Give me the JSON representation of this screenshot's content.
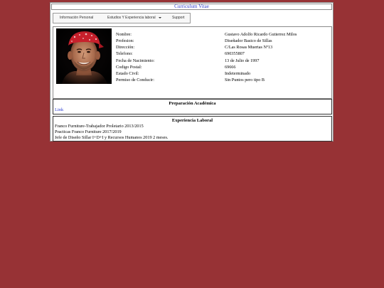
{
  "header": {
    "title": "Curriculum Vitae"
  },
  "nav": {
    "items": [
      {
        "label": "Información Personal"
      },
      {
        "label": "Estudios Y Experiencia laboral"
      },
      {
        "label": "Support"
      }
    ]
  },
  "profile": {
    "photo_icon": "profile-photo",
    "fields": [
      {
        "label": "Nombre:",
        "value": "Gustavo Adolfo Ricardo Gutierrez Milos"
      },
      {
        "label": "Profesion:",
        "value": "Diseñador Basico de Sillas"
      },
      {
        "label": "Dirección:",
        "value": "C/Las Rosas Muertas Nº13"
      },
      {
        "label": "Telefono:",
        "value": "690355807"
      },
      {
        "label": "Fecha de Nacimiento:",
        "value": "13 de Julio de 1997"
      },
      {
        "label": "Codigo Postal:",
        "value": "69666"
      },
      {
        "label": "Estado Civil:",
        "value": "Indeterminado"
      },
      {
        "label": "Permiso de Conducir:",
        "value": "Sin Puntos pero tipo B"
      }
    ]
  },
  "education": {
    "heading": "Preparación Académica",
    "link_label": "Link"
  },
  "experience": {
    "heading": "Experiencia Laboral",
    "lines": [
      "Franco Furniture-Trabajador Proletario 2013/2015",
      "Practicas Franco Furniture 2017/2019",
      "Jefe de Diseño Sillar I+D+I y Recursos Humanos 2019 2 meses."
    ]
  },
  "colors": {
    "background": "#973235",
    "link": "#2d3dd0",
    "bandana": "#c8202c"
  }
}
